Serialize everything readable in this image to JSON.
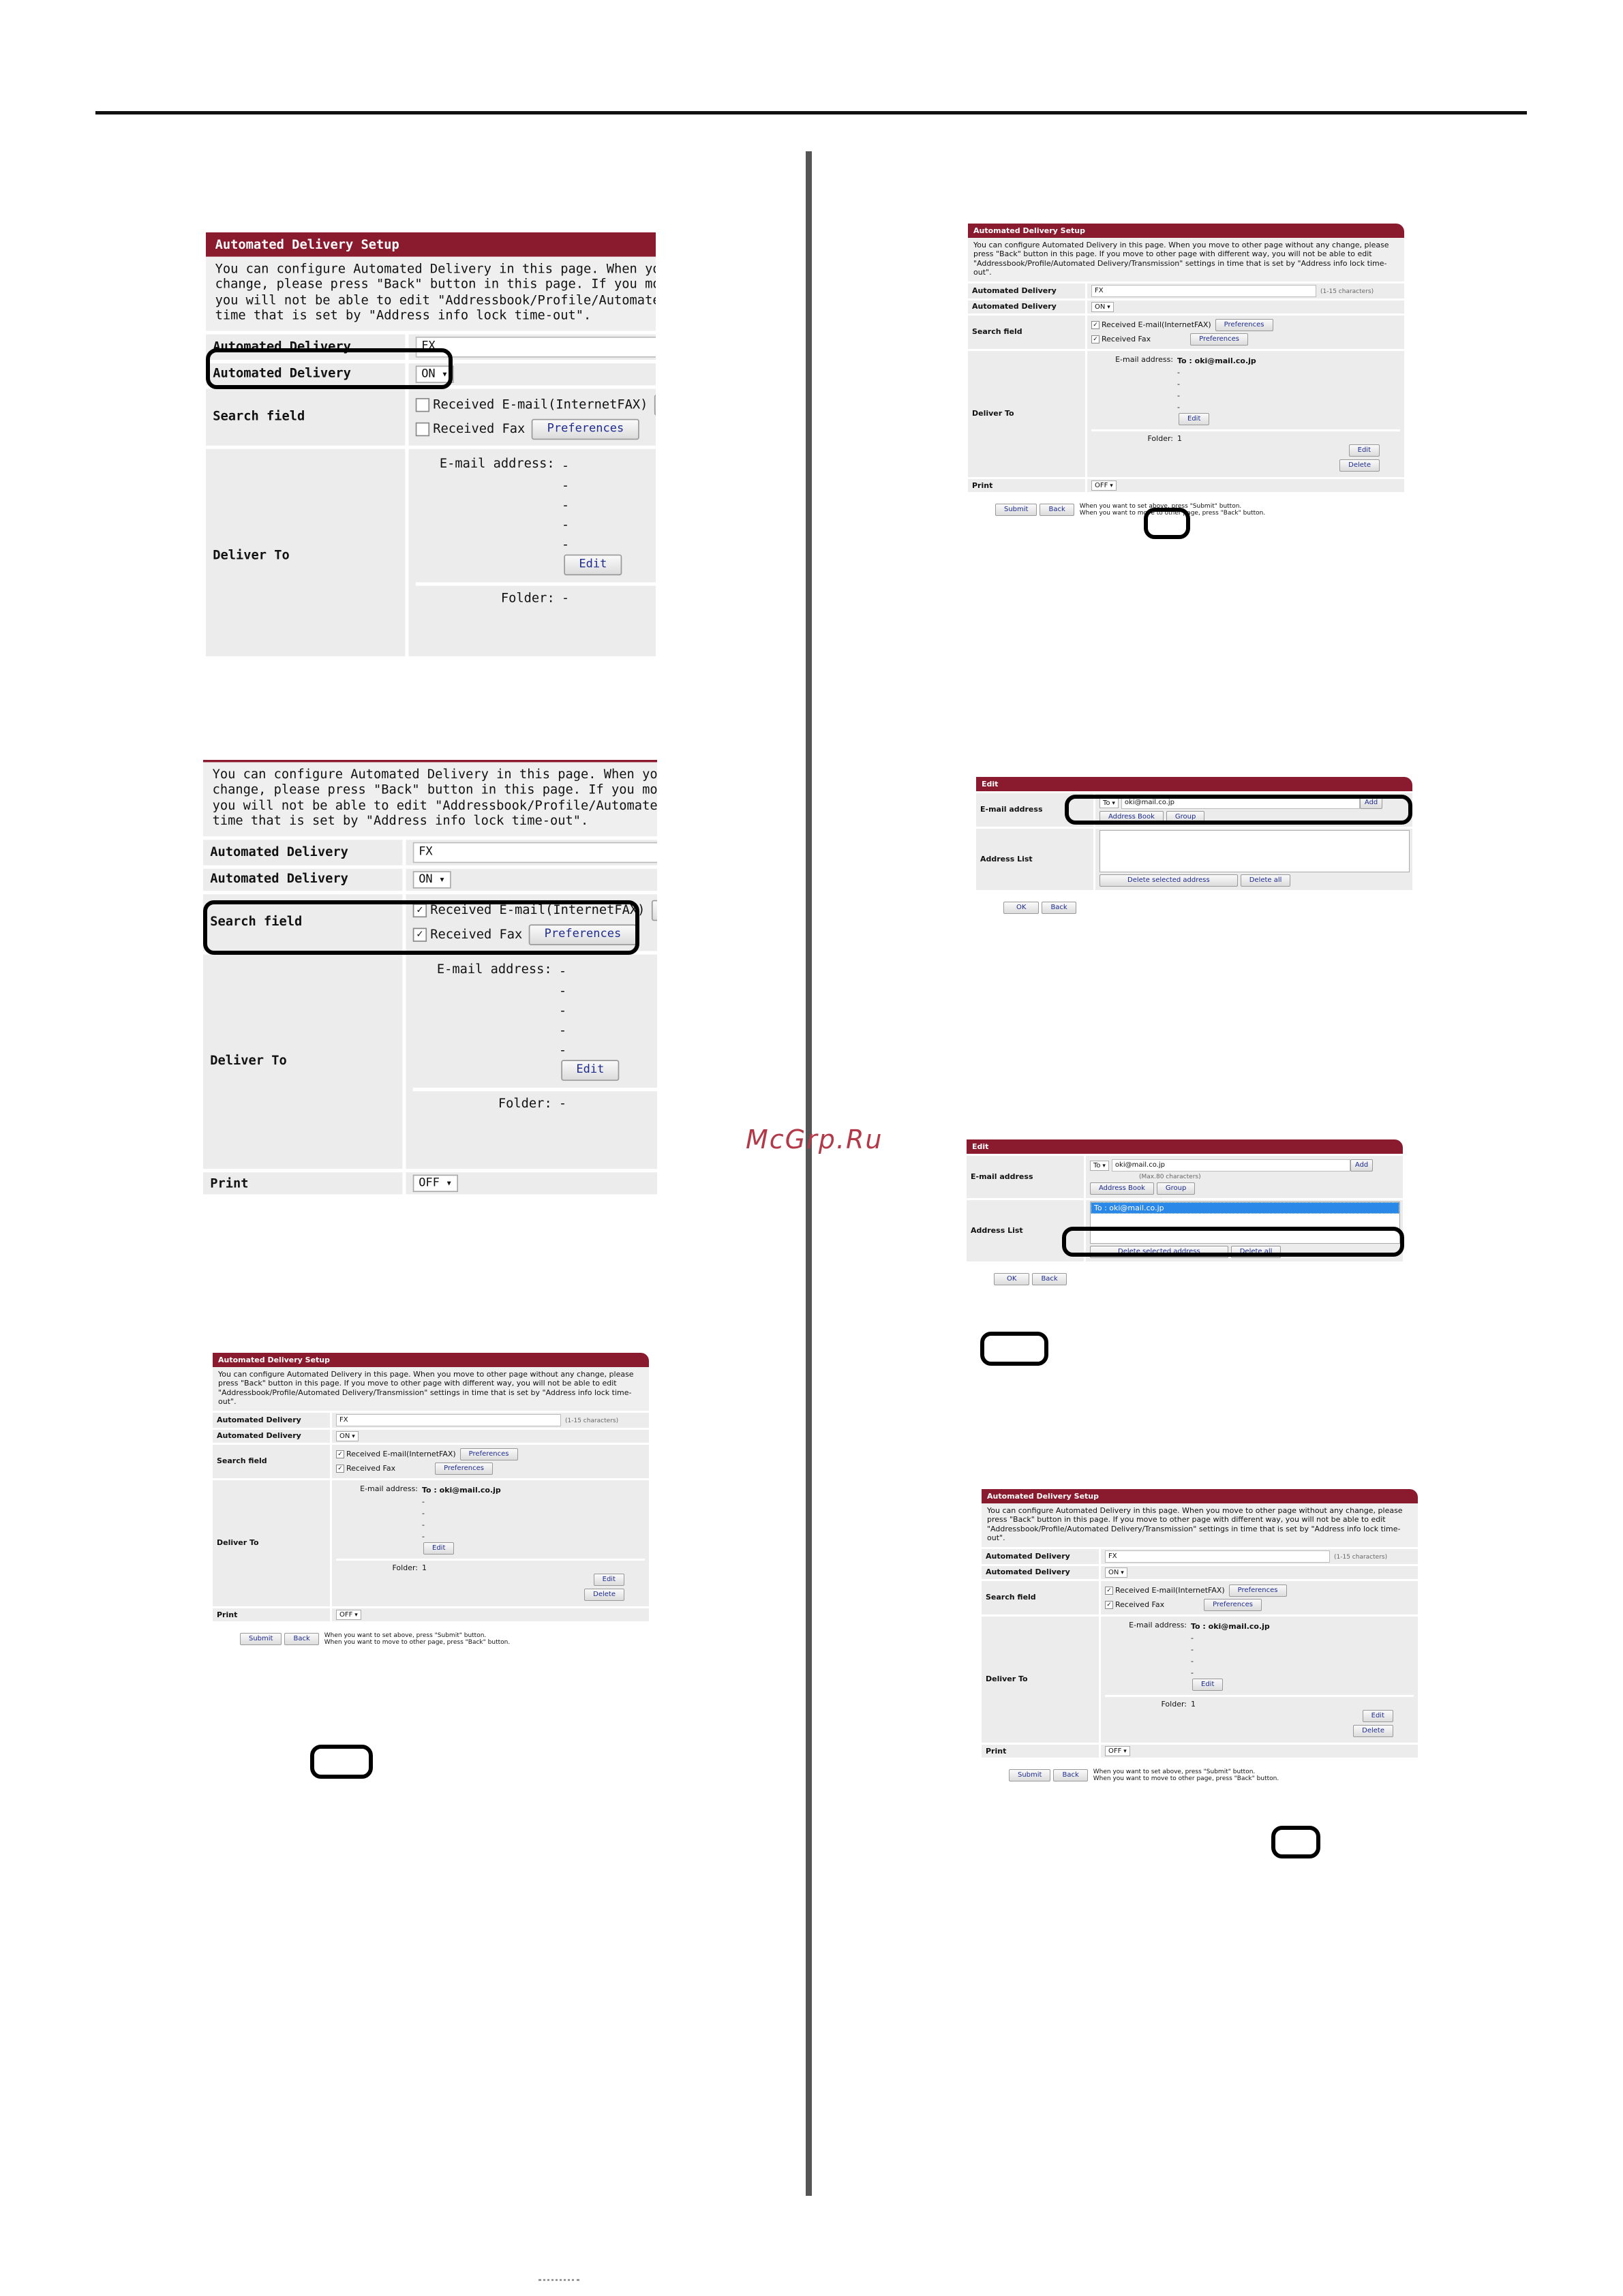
{
  "site_watermark": "McGrp.Ru",
  "setup": {
    "title": "Automated Delivery Setup",
    "intro": "You can configure Automated Delivery in this page. When you move to other page without any change, please press \"Back\" button in this page. If you move to other page with different way, you will not be able to edit \"Addressbook/Profile/Automated Delivery/Transmission\" settings in time that is set by \"Address info lock time-out\".",
    "name_label": "Automated Delivery",
    "name_value": "FX",
    "name_hint": "(1-15 characters)",
    "onoff_label": "Automated Delivery",
    "onoff_value": "ON",
    "search_label": "Search field",
    "search_opt1": "Received E-mail(InternetFAX)",
    "search_opt2": "Received Fax",
    "preferences": "Preferences",
    "deliver_label": "Deliver To",
    "email_key": "E-mail address:",
    "email_value": "To : oki@mail.co.jp",
    "dash": "-",
    "folder_key": "Folder:",
    "folder_value": "1",
    "edit": "Edit",
    "delete": "Delete",
    "print_label": "Print",
    "print_value": "OFF",
    "submit": "Submit",
    "back": "Back",
    "hint1": "When you want to set above, press \"Submit\" button.",
    "hint2": "When you want to move to other page, press \"Back\" button."
  },
  "edit_dialog": {
    "title": "Edit",
    "email_label": "E-mail address",
    "to": "To",
    "email": "oki@mail.co.jp",
    "add": "Add",
    "max_hint": "(Max.80 characters)",
    "address_book": "Address Book",
    "group": "Group",
    "list_label": "Address List",
    "list_item": "To : oki@mail.co.jp",
    "delete_selected": "Delete selected address",
    "delete_all": "Delete all",
    "ok": "OK",
    "back": "Back"
  }
}
